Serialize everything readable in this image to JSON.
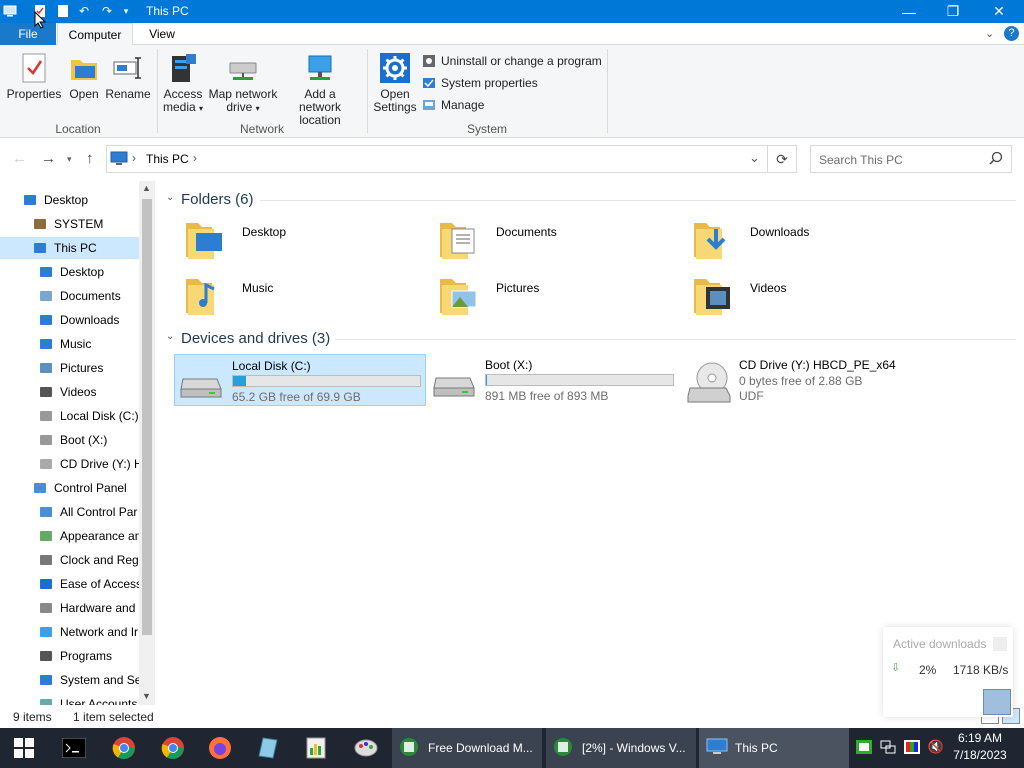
{
  "window": {
    "title": "This PC"
  },
  "quick_access": [
    "properties-icon",
    "new-folder-icon",
    "undo-icon",
    "redo-icon",
    "customize-chevron-icon"
  ],
  "ribbon_tabs": {
    "file": "File",
    "computer": "Computer",
    "view": "View"
  },
  "ribbon": {
    "location": {
      "label": "Location",
      "properties": "Properties",
      "open": "Open",
      "rename": "Rename"
    },
    "network": {
      "label": "Network",
      "access_media_1": "Access",
      "access_media_2": "media",
      "map_drive_1": "Map network",
      "map_drive_2": "drive",
      "add_location_1": "Add a network",
      "add_location_2": "location"
    },
    "system": {
      "label": "System",
      "open_settings_1": "Open",
      "open_settings_2": "Settings",
      "uninstall": "Uninstall or change a program",
      "system_properties": "System properties",
      "manage": "Manage"
    }
  },
  "address": {
    "path": "This PC",
    "search_placeholder": "Search This PC"
  },
  "nav_pane": [
    {
      "label": "Desktop",
      "icon": "desktop-icon",
      "indent": 0
    },
    {
      "label": "SYSTEM",
      "icon": "user-icon",
      "indent": 1
    },
    {
      "label": "This PC",
      "icon": "computer-icon",
      "indent": 1,
      "selected": true
    },
    {
      "label": "Desktop",
      "icon": "desktop-icon",
      "indent": 2
    },
    {
      "label": "Documents",
      "icon": "documents-icon",
      "indent": 2
    },
    {
      "label": "Downloads",
      "icon": "downloads-icon",
      "indent": 2
    },
    {
      "label": "Music",
      "icon": "music-icon",
      "indent": 2
    },
    {
      "label": "Pictures",
      "icon": "pictures-icon",
      "indent": 2
    },
    {
      "label": "Videos",
      "icon": "videos-icon",
      "indent": 2
    },
    {
      "label": "Local Disk (C:)",
      "icon": "drive-icon",
      "indent": 2
    },
    {
      "label": "Boot (X:)",
      "icon": "drive-icon",
      "indent": 2
    },
    {
      "label": "CD Drive (Y:) H",
      "icon": "cd-drive-icon",
      "indent": 2
    },
    {
      "label": "Control Panel",
      "icon": "control-panel-icon",
      "indent": 1
    },
    {
      "label": "All Control Par",
      "icon": "control-panel-icon",
      "indent": 2
    },
    {
      "label": "Appearance an",
      "icon": "appearance-icon",
      "indent": 2
    },
    {
      "label": "Clock and Regi",
      "icon": "clock-icon",
      "indent": 2
    },
    {
      "label": "Ease of Access",
      "icon": "ease-of-access-icon",
      "indent": 2
    },
    {
      "label": "Hardware and",
      "icon": "hardware-icon",
      "indent": 2
    },
    {
      "label": "Network and Ir",
      "icon": "network-icon",
      "indent": 2
    },
    {
      "label": "Programs",
      "icon": "programs-icon",
      "indent": 2
    },
    {
      "label": "System and Sec",
      "icon": "security-icon",
      "indent": 2
    },
    {
      "label": "User Accounts",
      "icon": "user-accounts-icon",
      "indent": 2
    }
  ],
  "folders": {
    "heading": "Folders (6)",
    "items": [
      {
        "name": "Desktop",
        "icon": "desktop-folder-icon"
      },
      {
        "name": "Documents",
        "icon": "documents-folder-icon"
      },
      {
        "name": "Downloads",
        "icon": "downloads-folder-icon"
      },
      {
        "name": "Music",
        "icon": "music-folder-icon"
      },
      {
        "name": "Pictures",
        "icon": "pictures-folder-icon"
      },
      {
        "name": "Videos",
        "icon": "videos-folder-icon"
      }
    ]
  },
  "drives": {
    "heading": "Devices and drives (3)",
    "items": [
      {
        "name": "Local Disk (C:)",
        "free": "65.2 GB free of 69.9 GB",
        "used_fraction": 0.067,
        "selected": true
      },
      {
        "name": "Boot (X:)",
        "free": "891 MB free of 893 MB",
        "used_fraction": 0.002
      },
      {
        "name": "CD Drive (Y:) HBCD_PE_x64",
        "free": "0 bytes free of 2.88 GB",
        "fs": "UDF"
      }
    ]
  },
  "status": {
    "items": "9 items",
    "selected": "1 item selected"
  },
  "notification": {
    "title": "Active downloads",
    "percent": "2%",
    "speed": "1718 KB/s"
  },
  "taskbar": {
    "pinned": [
      "start-icon",
      "terminal-icon",
      "chrome-icon",
      "chrome-icon",
      "firefox-icon",
      "notepad-icon",
      "spreadsheet-icon",
      "paint-icon"
    ],
    "windows": [
      {
        "label": "Free Download M..."
      },
      {
        "label": "[2%] - Windows V..."
      },
      {
        "label": "This PC",
        "active": true
      }
    ],
    "time": "6:19 AM",
    "date": "7/18/2023"
  },
  "colors": {
    "accent": "#0078d7",
    "selection": "#cce8ff",
    "progress": "#26a0da",
    "taskbar": "#1f2631"
  }
}
